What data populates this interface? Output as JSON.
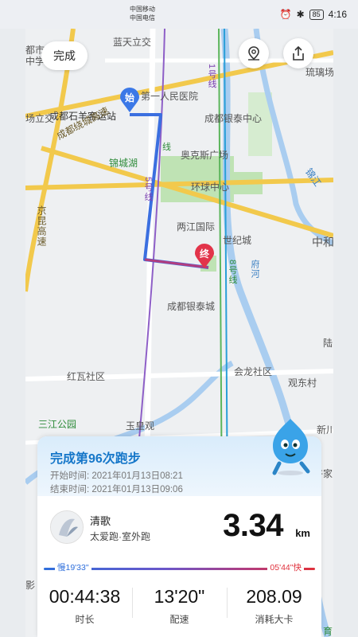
{
  "status": {
    "carrier1": "中国移动",
    "carrier2": "中国电信",
    "battery": "85",
    "time": "4:16"
  },
  "toolbar": {
    "done_label": "完成",
    "pin_icon": "map-pin-icon",
    "share_icon": "share-icon"
  },
  "map": {
    "labels": {
      "l1": "蓝天立交",
      "l2": "琉璃场",
      "l3": "都市",
      "l4": "中学",
      "l5": "第一人民医院",
      "l6": "成都石羊客运站",
      "l7": "成都银泰中心",
      "l8": "成都绕城高速",
      "l9": "锦城湖",
      "l10": "奥克斯广场",
      "l11": "环球中心",
      "l12": "两江国际",
      "l13": "世纪城",
      "l14": "中和",
      "l15": "成都银泰城",
      "l16": "红瓦社区",
      "l17": "会龙社区",
      "l18": "观东村",
      "l19": "三江公园",
      "l20": "玉皇观",
      "l21": "新川之心",
      "l22": "陆",
      "l23": "场立交",
      "l24": "京昆高速",
      "l25": "1号线",
      "l26": "5号线",
      "l27": "8号线",
      "l28": "线",
      "l29": "锦江",
      "l30": "府河",
      "l31": "许家",
      "l32": "影",
      "l33": "育"
    },
    "start_marker": "始",
    "end_marker": "终",
    "route_color": "#3b6fe0",
    "route_end_color": "#b23d7f"
  },
  "card": {
    "title": "完成第96次跑步",
    "start_label": "开始时间:",
    "start_value": "2021年01月13日08:21",
    "end_label": "结束时间:",
    "end_value": "2021年01月13日09:06",
    "user_name": "清歌",
    "user_tags": "太爱跑·室外跑",
    "distance": "3.34",
    "distance_unit": "km",
    "pace_slow": "慢19'33\"",
    "pace_fast": "05'44\"快",
    "stats": [
      {
        "value": "00:44:38",
        "label": "时长"
      },
      {
        "value": "13'20\"",
        "label": "配速"
      },
      {
        "value": "208.09",
        "label": "消耗大卡"
      }
    ]
  }
}
